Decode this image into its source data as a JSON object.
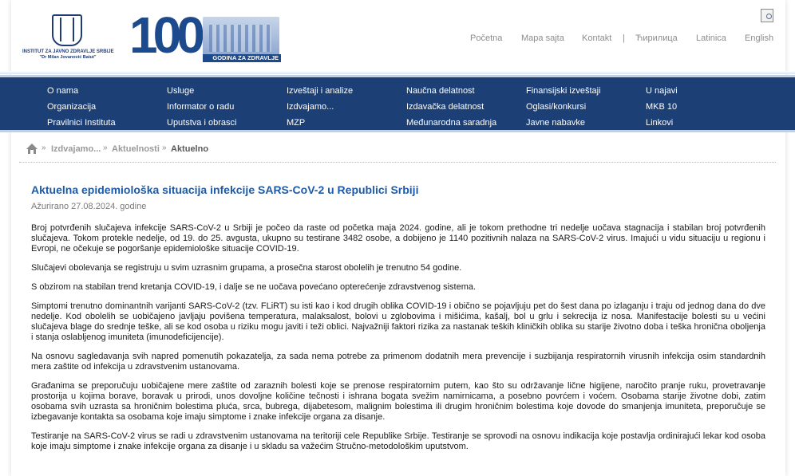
{
  "header": {
    "logo": {
      "line1": "INSTITUT ZA JAVNO ZDRAVLJE SRBIJE",
      "line2": "\"Dr Milan Jovanović Batut\""
    },
    "centenary": {
      "number": "100",
      "tagline": "GODINA ZA ZDRAVLJE"
    },
    "toplinks": {
      "home": "Početna",
      "sitemap": "Mapa sajta",
      "contact": "Kontakt",
      "separator": "|",
      "cyrillic": "Ћирилица",
      "latinica": "Latinica",
      "english": "English"
    }
  },
  "nav": {
    "col1": [
      "O nama",
      "Organizacija",
      "Pravilnici Instituta"
    ],
    "col2": [
      "Usluge",
      "Informator o radu",
      "Uputstva i obrasci"
    ],
    "col3": [
      "Izveštaji i analize",
      "Izdvajamo...",
      "MZP"
    ],
    "col4": [
      "Naučna delatnost",
      "Izdavačka delatnost",
      "Međunarodna saradnja"
    ],
    "col5": [
      "Finansijski izveštaji",
      "Oglasi/konkursi",
      "Javne nabavke"
    ],
    "col6": [
      "U najavi",
      "MKB 10",
      "Linkovi"
    ]
  },
  "breadcrumb": [
    "Izdvajamo...",
    "Aktuelnosti",
    "Aktuelno"
  ],
  "article": {
    "title": "Aktuelna epidemiološka situacija infekcije SARS-CoV-2 u Republici Srbiji",
    "updated": "Ažurirano 27.08.2024. godine",
    "paragraphs": [
      "Broj potvrđenih slučajeva infekcije SARS-CoV-2 u Srbiji je počeo da raste od početka maja 2024. godine, ali je tokom prethodne tri nedelje uočava stagnacija i stabilan broj potvrđenih slučajeva. Tokom protekle nedelje, od 19. do 25. avgusta, ukupno su testirane 3482 osobe, a dobijeno je 1140 pozitivnih nalaza na SARS-CoV-2 virus. Imajući u vidu situaciju u regionu i Evropi, ne očekuje se pogoršanje epidemiološke situacije COVID-19.",
      "Slučajevi obolevanja se registruju u svim uzrasnim grupama, a prosečna starost obolelih je trenutno 54 godine.",
      "S obzirom na stabilan trend kretanja COVID-19, i dalje se ne uočava povećano opterećenje zdravstvenog sistema.",
      "Simptomi trenutno dominantnih varijanti SARS-CoV-2 (tzv. FLiRT) su isti kao i kod drugih oblika COVID-19 i obično se pojavljuju pet do šest dana po izlaganju i traju od jednog dana do dve nedelje. Kod obolelih se uobičajeno javljaju povišena temperatura, malaksalost, bolovi u zglobovima i mišićima, kašalj, bol u grlu i sekrecija iz nosa. Manifestacije bolesti su u većini slučajeva blage do srednje teške, ali se kod osoba u riziku mogu javiti i teži oblici. Najvažniji faktori rizika za nastanak teških kliničkih oblika su starije životno doba i teška hronična oboljenja i stanja oslabljenog imuniteta (imunodeficijencije).",
      "Na osnovu sagledavanja svih napred pomenutih pokazatelja, za sada nema potrebe za primenom dodatnih mera prevencije i suzbijanja respiratornih virusnih infekcija osim standardnih mera zaštite od infekcija u zdravstvenim ustanovama.",
      "Građanima se preporučuju uobičajene mere zaštite od zaraznih bolesti koje se prenose respiratornim putem, kao što su održavanje lične higijene, naročito pranje ruku, provetravanje prostorija u kojima borave, boravak u prirodi, unos dovoljne količine tečnosti i ishrana bogata svežim namirnicama, a posebno povrćem i voćem. Osobama starije životne dobi, zatim osobama svih uzrasta sa hroničnim bolestima pluća, srca, bubrega, dijabetesom, malignim bolestima ili drugim hroničnim bolestima koje dovode do smanjenja imuniteta, preporučuje se izbegavanje kontakta sa osobama koje imaju simptome i znake infekcije organa za disanje.",
      "Testiranje na SARS-CoV-2 virus se radi u zdravstvenim ustanovama na teritoriji cele Republike Srbije. Testiranje se sprovodi na osnovu indikacija koje postavlja ordinirajući lekar kod osoba koje imaju simptome i znake infekcije organa za disanje i u skladu sa važećim Stručno-metodološkim uputstvom."
    ]
  },
  "colors": {
    "nav_background": "#1c3f75",
    "title_color": "#1e5aa8",
    "brand_blue": "#1d4a8c"
  },
  "icons": [
    "print-preview-icon",
    "home-icon"
  ]
}
